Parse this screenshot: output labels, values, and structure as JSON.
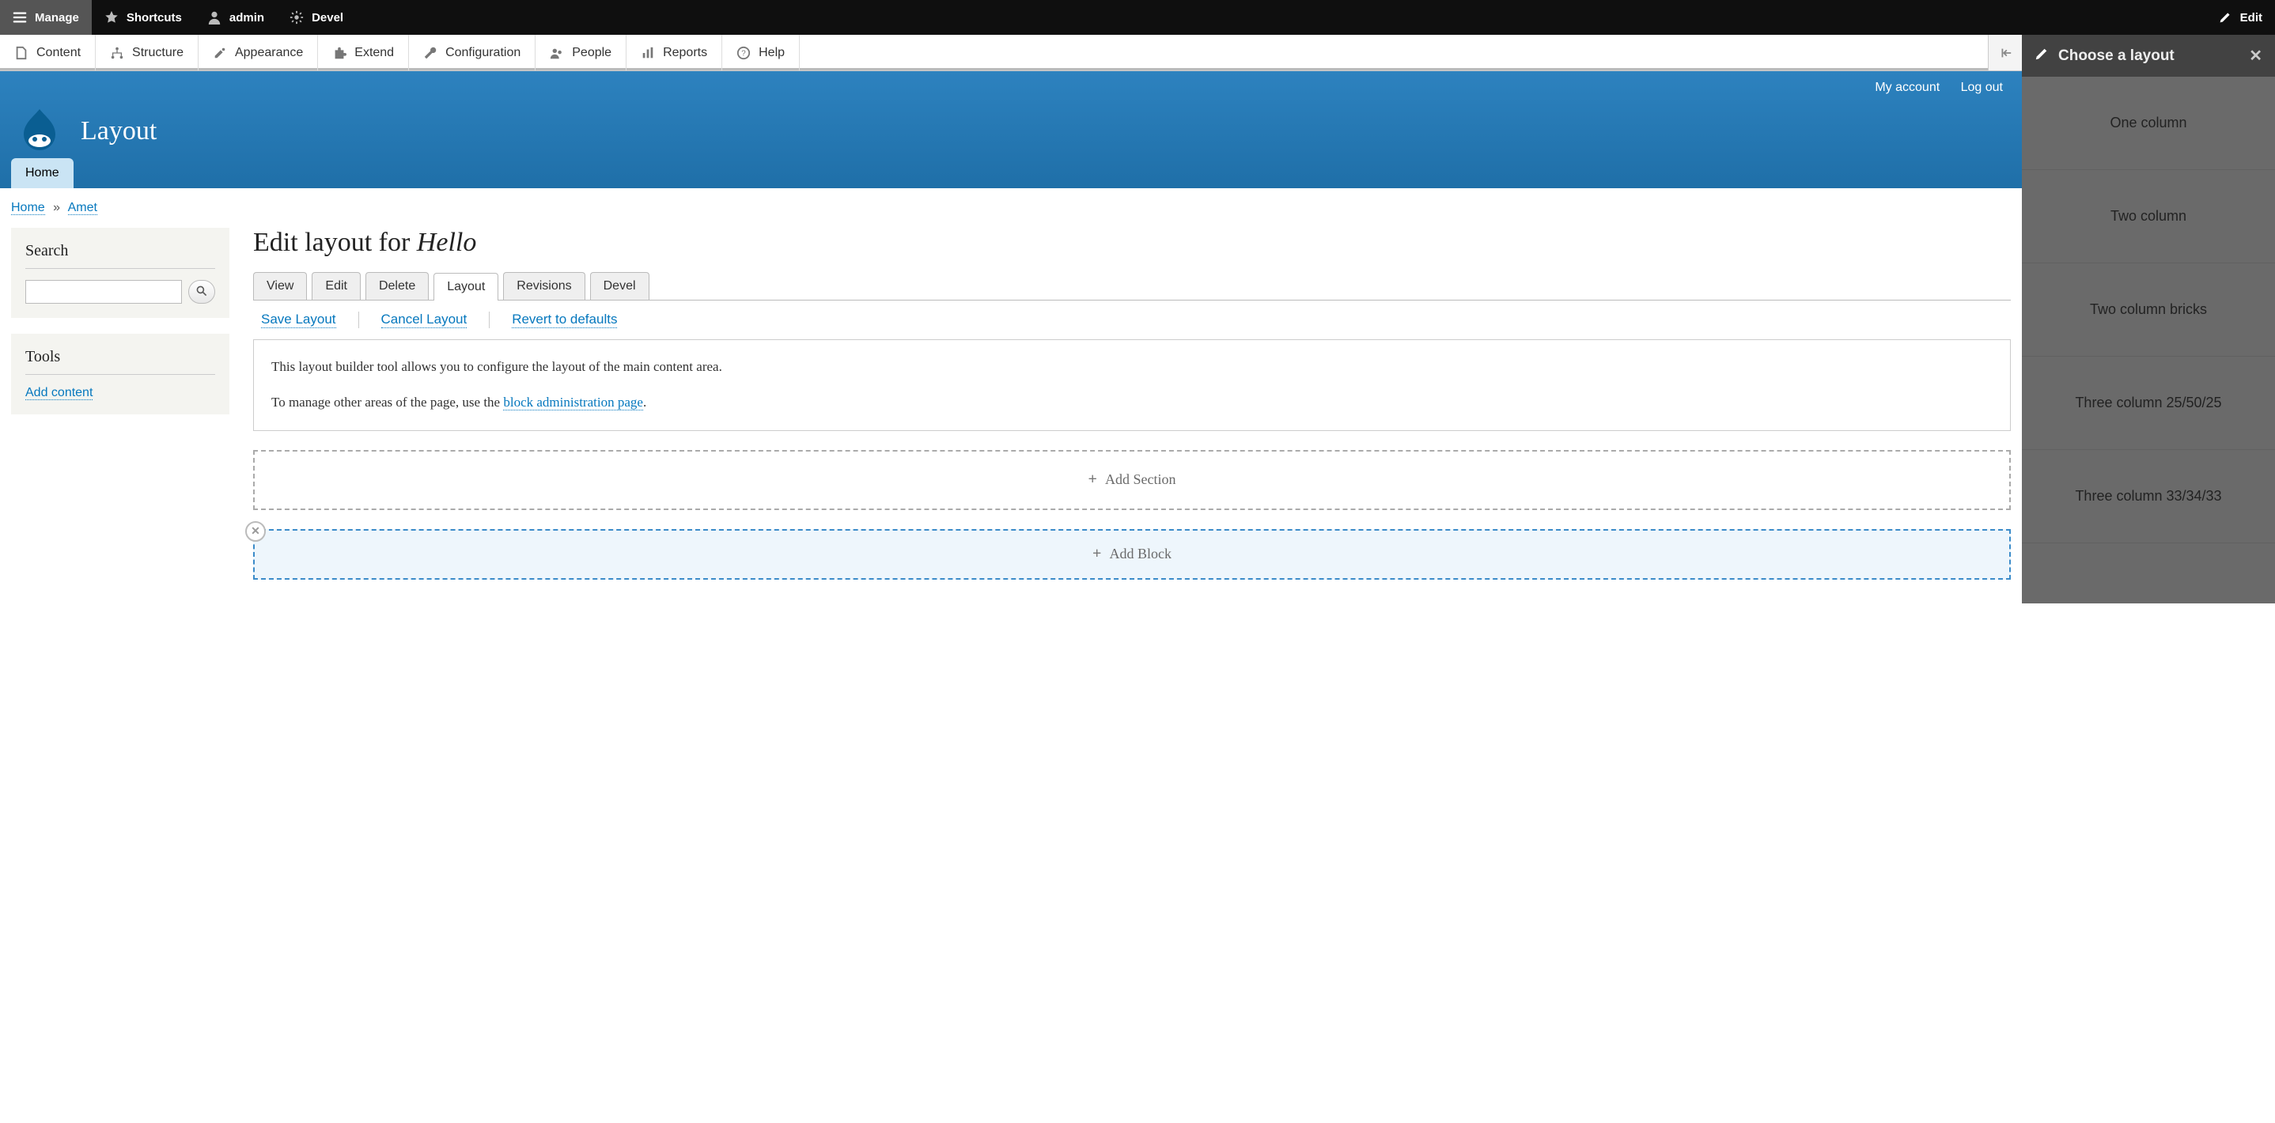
{
  "toolbar": {
    "manage": "Manage",
    "shortcuts": "Shortcuts",
    "user": "admin",
    "devel": "Devel",
    "edit": "Edit"
  },
  "adminmenu": {
    "content": "Content",
    "structure": "Structure",
    "appearance": "Appearance",
    "extend": "Extend",
    "configuration": "Configuration",
    "people": "People",
    "reports": "Reports",
    "help": "Help"
  },
  "header": {
    "my_account": "My account",
    "log_out": "Log out",
    "site_title": "Layout",
    "home_tab": "Home"
  },
  "breadcrumb": {
    "home": "Home",
    "sep": "»",
    "current": "Amet"
  },
  "sidebar": {
    "search_title": "Search",
    "tools_title": "Tools",
    "add_content": "Add content"
  },
  "main": {
    "title_prefix": "Edit layout for ",
    "title_em": "Hello",
    "tabs": [
      "View",
      "Edit",
      "Delete",
      "Layout",
      "Revisions",
      "Devel"
    ],
    "active_tab_index": 3,
    "actions": {
      "save": "Save Layout",
      "cancel": "Cancel Layout",
      "revert": "Revert to defaults"
    },
    "info_line1": "This layout builder tool allows you to configure the layout of the main content area.",
    "info_line2_pre": "To manage other areas of the page, use the ",
    "info_line2_link": "block administration page",
    "info_line2_post": ".",
    "add_section": "Add Section",
    "add_block": "Add Block"
  },
  "offcanvas": {
    "title": "Choose a layout",
    "options": [
      "One column",
      "Two column",
      "Two column bricks",
      "Three column 25/50/25",
      "Three column 33/34/33"
    ]
  }
}
